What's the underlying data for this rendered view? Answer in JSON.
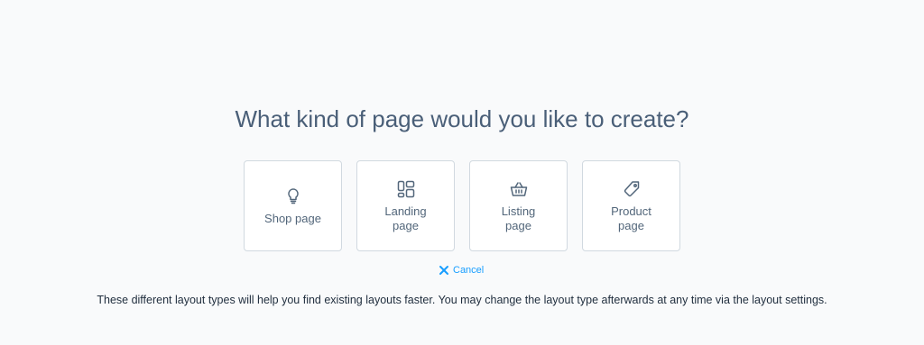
{
  "dialog": {
    "title": "What kind of page would you like to create?",
    "cards": [
      {
        "label": "Shop page",
        "icon": "lightbulb-icon"
      },
      {
        "label": "Landing page",
        "icon": "layout-grid-icon"
      },
      {
        "label": "Listing page",
        "icon": "basket-icon"
      },
      {
        "label": "Product page",
        "icon": "tag-icon"
      }
    ],
    "cancel_label": "Cancel",
    "hint": "These different layout types will help you find existing layouts faster. You may change the layout type afterwards at any time via the layout settings."
  },
  "colors": {
    "accent": "#189eff",
    "text": "#52667a",
    "border": "#d1d9e0",
    "background": "#f9fafb"
  }
}
